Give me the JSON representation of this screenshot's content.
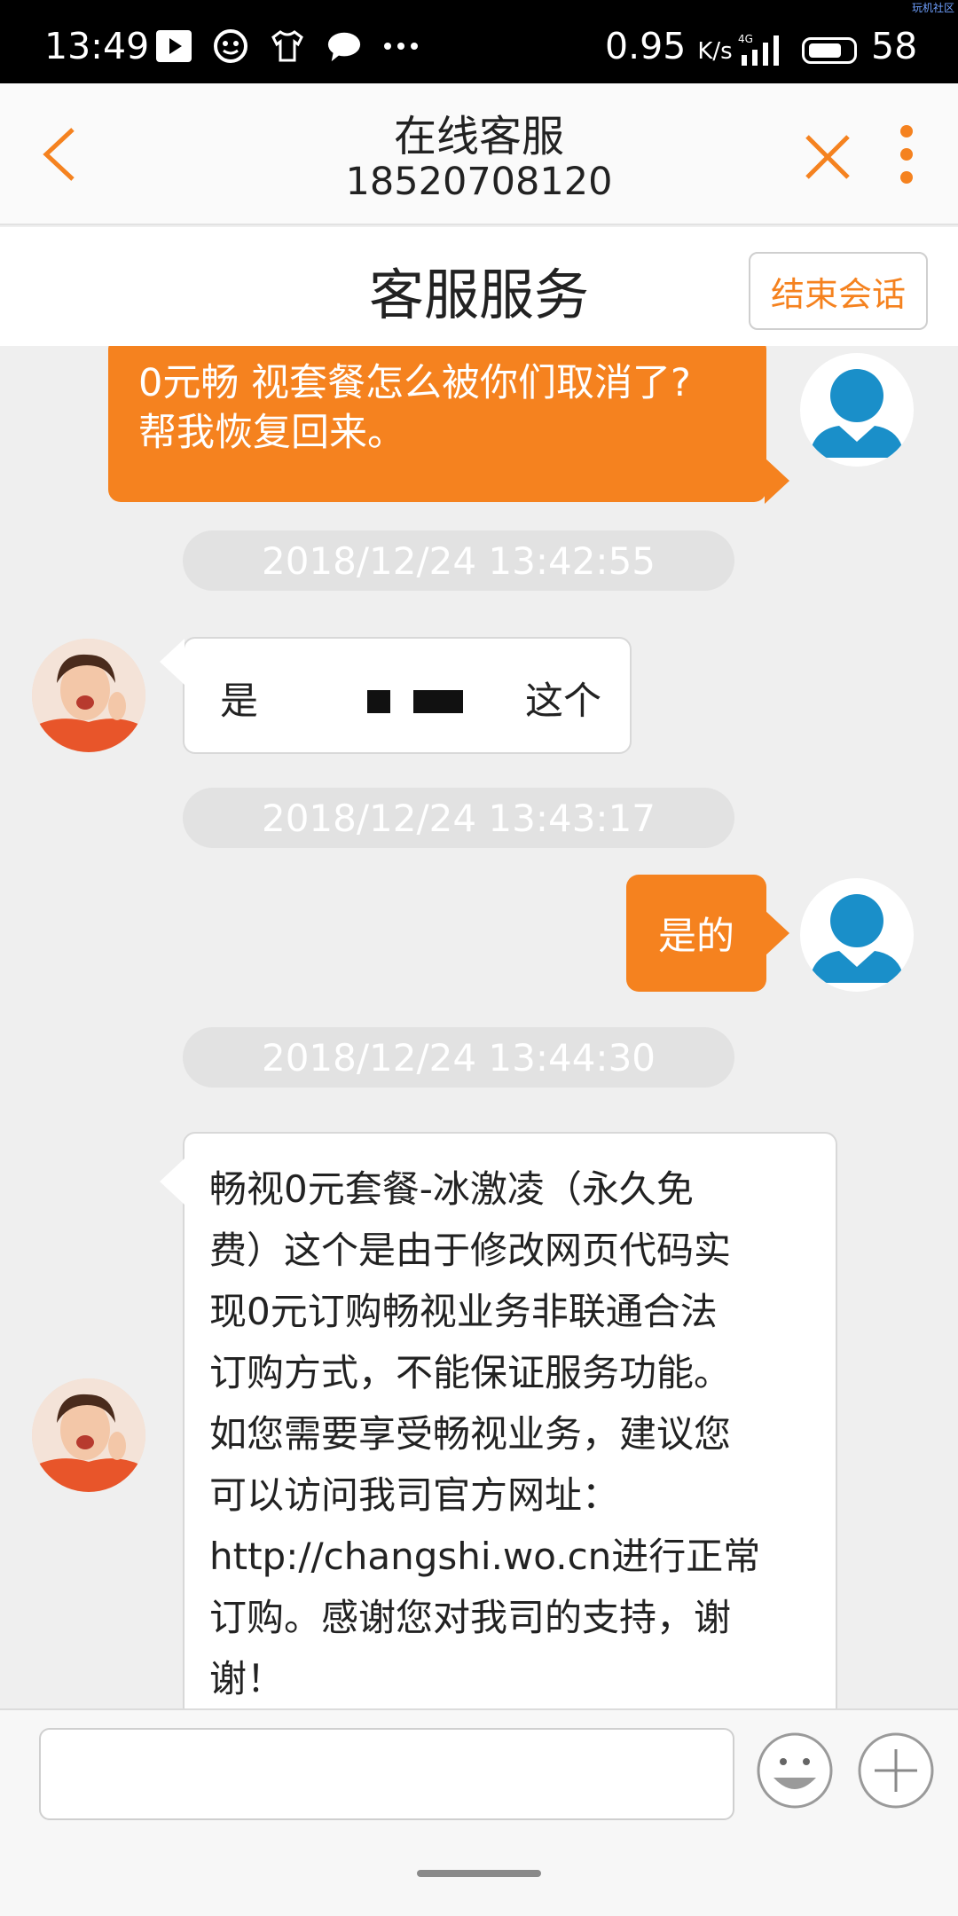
{
  "status_bar": {
    "time": "13:49",
    "speed": "0.95",
    "speed_unit": "K/s",
    "network": "4G",
    "battery": "58",
    "watermark": "玩机社区",
    "icons": [
      "youtube-icon",
      "robot-icon",
      "tshirt-icon",
      "chat-icon",
      "more-dots-icon"
    ]
  },
  "header": {
    "title": "在线客服",
    "phone": "18520708120"
  },
  "subheader": {
    "title": "客服服务",
    "end_button": "结束会话"
  },
  "messages": [
    {
      "from": "user",
      "text_line1": "0元畅 视套餐怎么被你们取消了?",
      "text_line2": "帮我恢复回来。"
    },
    {
      "type": "timestamp",
      "text": "2018/12/24 13:42:55"
    },
    {
      "from": "agent",
      "text_start": "是",
      "text_end": "这个"
    },
    {
      "type": "timestamp",
      "text": "2018/12/24 13:43:17"
    },
    {
      "from": "user",
      "text": "是的"
    },
    {
      "type": "timestamp",
      "text": "2018/12/24 13:44:30"
    },
    {
      "from": "agent",
      "lines": [
        " 畅视0元套餐-冰激凌（永久免",
        "费）这个是由于修改网页代码实",
        "现0元订购畅视业务非联通合法",
        "订购方式，不能保证服务功能。",
        "如您需要享受畅视业务，建议您",
        "可以访问我司官方网址：",
        "http://changshi.wo.cn进行正常",
        "订购。感谢您对我司的支持，谢",
        "谢！"
      ]
    }
  ],
  "input": {
    "value": "",
    "placeholder": ""
  },
  "colors": {
    "accent": "#f5821f",
    "user_avatar": "#1a8fc9"
  }
}
